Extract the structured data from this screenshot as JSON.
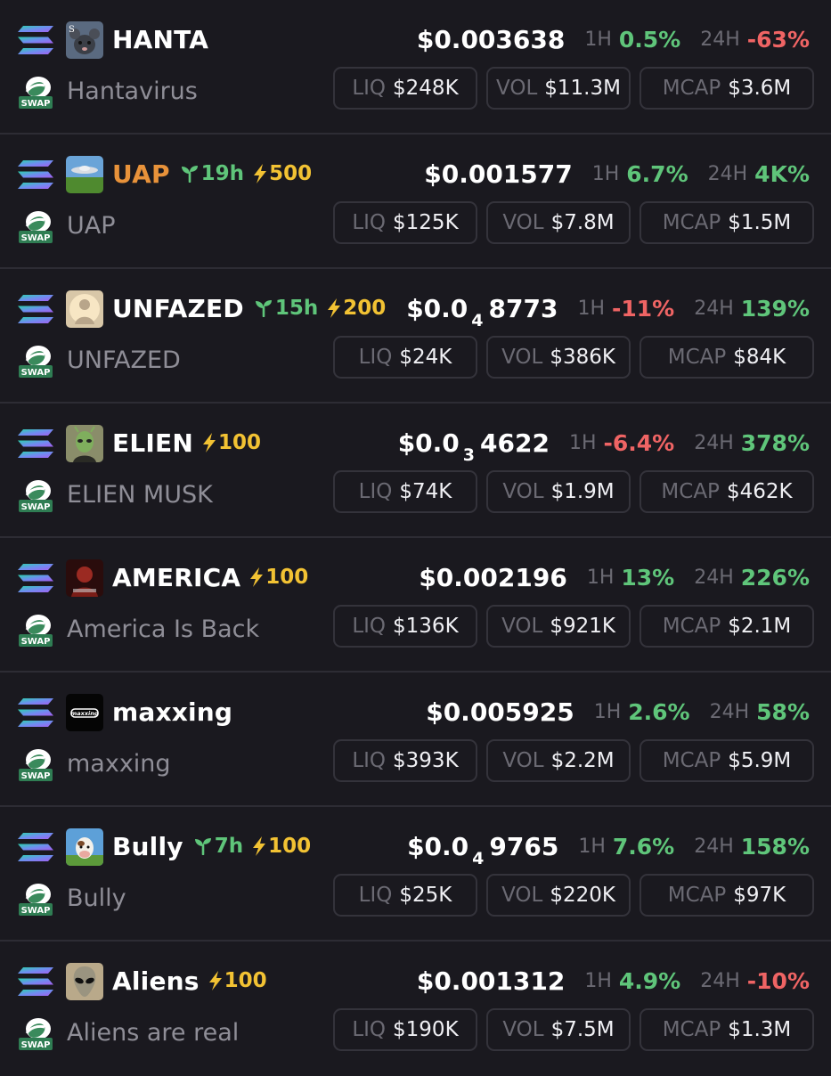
{
  "labels": {
    "h1": "1H",
    "h24": "24H",
    "liq": "LIQ",
    "vol": "VOL",
    "mcap": "MCAP",
    "swap": "SWAP"
  },
  "colors": {
    "background": "#1a191f",
    "positive": "#5fc57a",
    "negative": "#ef6464",
    "boost": "#f2c233",
    "highlight_ticker": "#e8923a"
  },
  "tokens": [
    {
      "ticker": "HANTA",
      "name": "Hantavirus",
      "avatar_icon": "rat-avatar-icon",
      "age": null,
      "boost": null,
      "price": "$0.003638",
      "price_sub": null,
      "price_tail": null,
      "change_1h": "0.5%",
      "change_1h_dir": "pos",
      "change_24h": "-63%",
      "change_24h_dir": "neg",
      "liq": "$248K",
      "vol": "$11.3M",
      "mcap": "$3.6M"
    },
    {
      "ticker": "UAP",
      "name": "UAP",
      "avatar_icon": "ufo-avatar-icon",
      "ticker_color": "orange",
      "age": "19h",
      "boost": "500",
      "price": "$0.001577",
      "price_sub": null,
      "price_tail": null,
      "change_1h": "6.7%",
      "change_1h_dir": "pos",
      "change_24h": "4K%",
      "change_24h_dir": "pos",
      "liq": "$125K",
      "vol": "$7.8M",
      "mcap": "$1.5M"
    },
    {
      "ticker": "UNFAZED",
      "name": "UNFAZED",
      "avatar_icon": "glowing-figure-avatar-icon",
      "age": "15h",
      "boost": "200",
      "price": "$0.0",
      "price_sub": "4",
      "price_tail": "8773",
      "change_1h": "-11%",
      "change_1h_dir": "neg",
      "change_24h": "139%",
      "change_24h_dir": "pos",
      "liq": "$24K",
      "vol": "$386K",
      "mcap": "$84K"
    },
    {
      "ticker": "ELIEN",
      "name": "ELIEN MUSK",
      "avatar_icon": "alien-musk-avatar-icon",
      "age": null,
      "boost": "100",
      "price": "$0.0",
      "price_sub": "3",
      "price_tail": "4622",
      "change_1h": "-6.4%",
      "change_1h_dir": "neg",
      "change_24h": "378%",
      "change_24h_dir": "pos",
      "liq": "$74K",
      "vol": "$1.9M",
      "mcap": "$462K"
    },
    {
      "ticker": "AMERICA",
      "name": "America Is Back",
      "avatar_icon": "america-avatar-icon",
      "age": null,
      "boost": "100",
      "price": "$0.002196",
      "price_sub": null,
      "price_tail": null,
      "change_1h": "13%",
      "change_1h_dir": "pos",
      "change_24h": "226%",
      "change_24h_dir": "pos",
      "liq": "$136K",
      "vol": "$921K",
      "mcap": "$2.1M"
    },
    {
      "ticker": "maxxing",
      "name": "maxxing",
      "avatar_icon": "maxxing-logo-avatar-icon",
      "age": null,
      "boost": null,
      "price": "$0.005925",
      "price_sub": null,
      "price_tail": null,
      "change_1h": "2.6%",
      "change_1h_dir": "pos",
      "change_24h": "58%",
      "change_24h_dir": "pos",
      "liq": "$393K",
      "vol": "$2.2M",
      "mcap": "$5.9M"
    },
    {
      "ticker": "Bully",
      "name": "Bully",
      "avatar_icon": "cow-avatar-icon",
      "age": "7h",
      "boost": "100",
      "price": "$0.0",
      "price_sub": "4",
      "price_tail": "9765",
      "change_1h": "7.6%",
      "change_1h_dir": "pos",
      "change_24h": "158%",
      "change_24h_dir": "pos",
      "liq": "$25K",
      "vol": "$220K",
      "mcap": "$97K"
    },
    {
      "ticker": "Aliens",
      "name": "Aliens are real",
      "avatar_icon": "grey-alien-avatar-icon",
      "age": null,
      "boost": "100",
      "price": "$0.001312",
      "price_sub": null,
      "price_tail": null,
      "change_1h": "4.9%",
      "change_1h_dir": "pos",
      "change_24h": "-10%",
      "change_24h_dir": "neg",
      "liq": "$190K",
      "vol": "$7.5M",
      "mcap": "$1.3M"
    }
  ]
}
